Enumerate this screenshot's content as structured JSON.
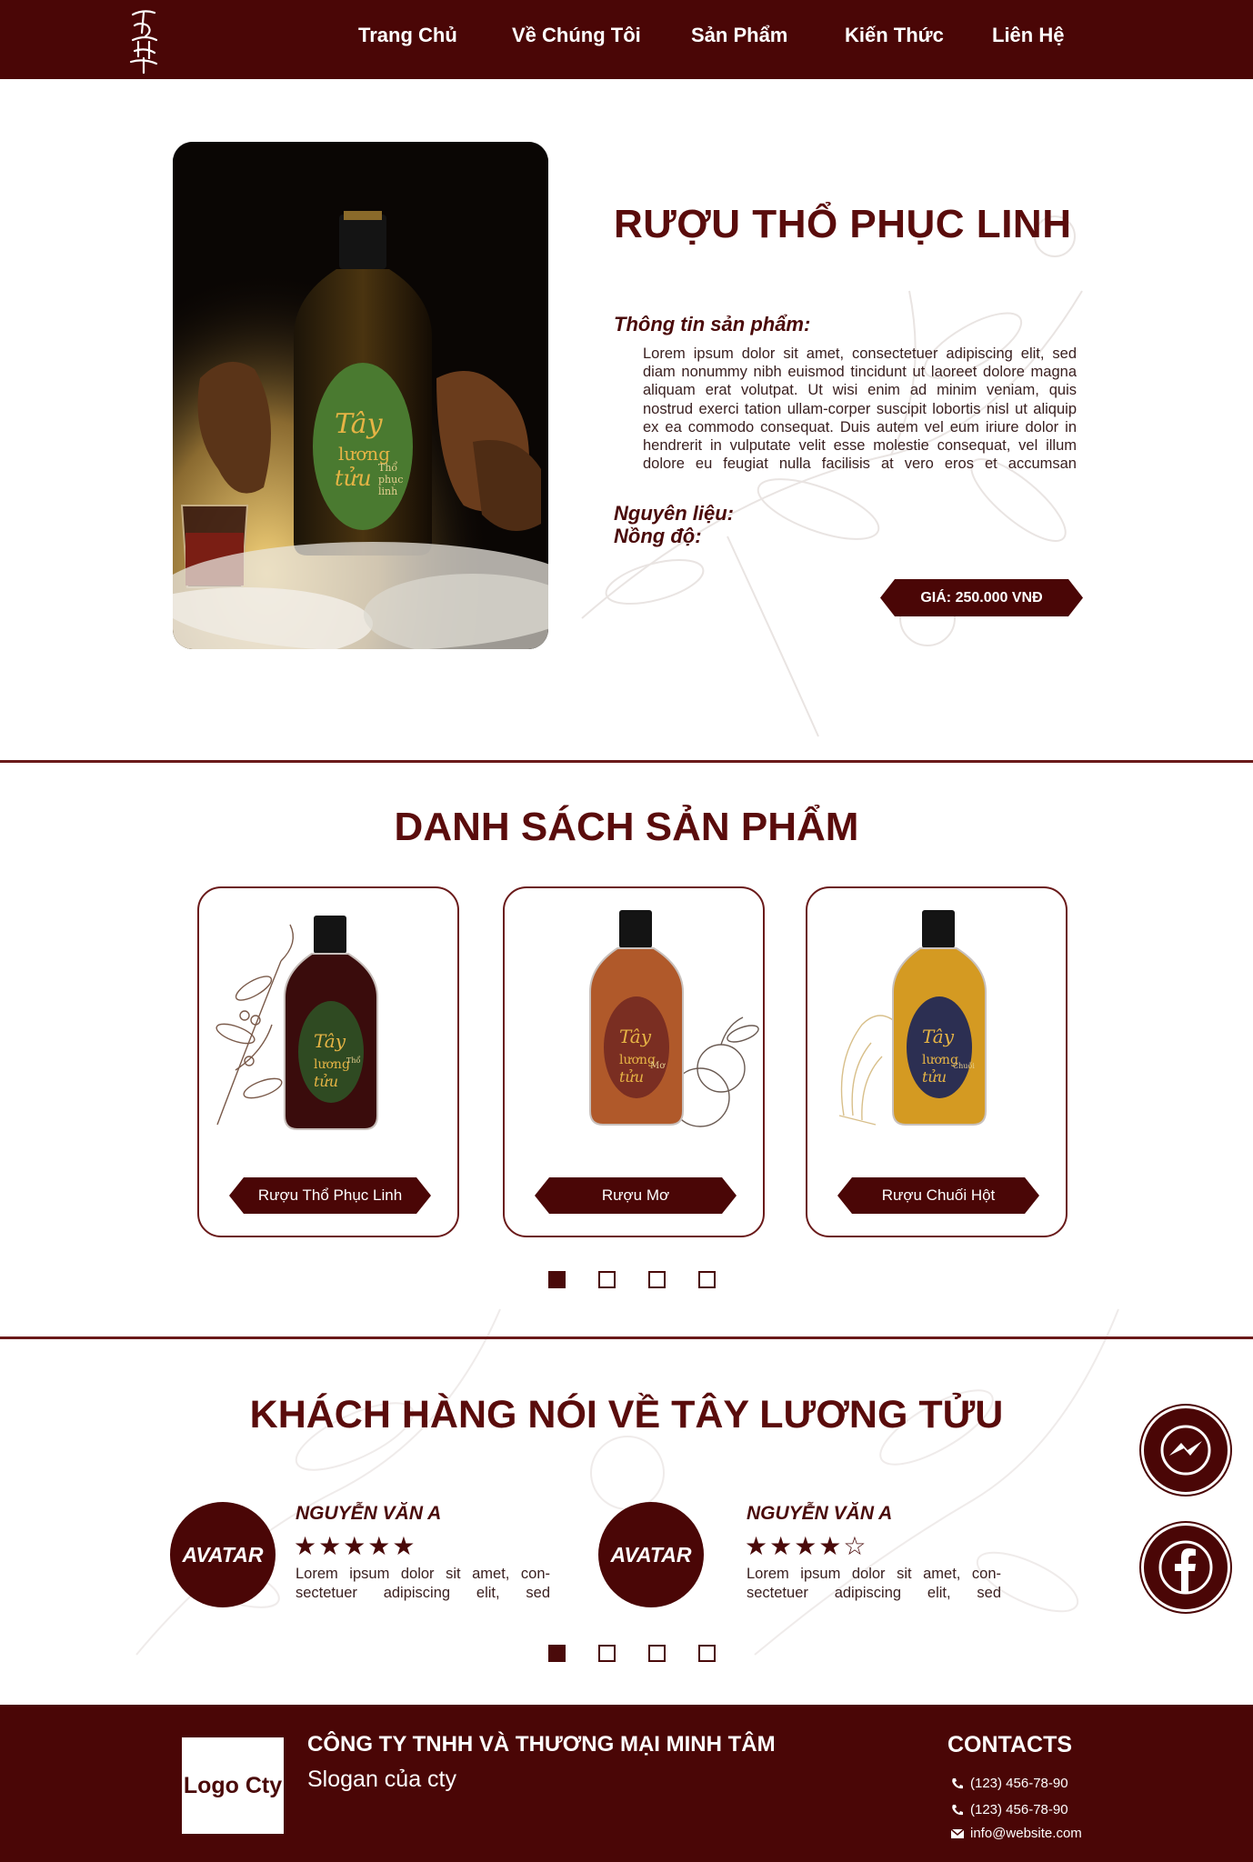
{
  "nav": {
    "logo_text": "Tây Lương Tửu",
    "items": [
      "Trang Chủ",
      "Về Chúng Tôi",
      "Sản Phẩm",
      "Kiến Thức",
      "Liên Hệ"
    ]
  },
  "hero": {
    "title": "RƯỢU THỔ PHỤC LINH",
    "info_label": "Thông tin sản phẩm:",
    "info_text": "Lorem ipsum dolor sit amet, consectetuer adipiscing elit, sed diam nonummy nibh euismod tincidunt ut laoreet dolore magna aliquam erat volutpat. Ut wisi enim ad minim veniam, quis nostrud exerci tation ullam-corper suscipit lobortis nisl ut aliquip ex ea commodo consequat. Duis autem vel eum iriure dolor in hendrerit in vulputate velit esse molestie consequat, vel illum dolore eu feugiat nulla facilisis at vero eros et accumsan",
    "ingredients_label": "Nguyên liệu:",
    "strength_label": "Nồng độ:",
    "price": "GIÁ: 250.000 VNĐ",
    "label_line1": "Thổ",
    "label_line2": "phục",
    "label_line3": "linh"
  },
  "products": {
    "title": "DANH SÁCH SẢN PHẨM",
    "items": [
      {
        "name": "Rượu Thổ Phục Linh",
        "label_text": "Thổ phục linh",
        "liquid": "#3a0c0c",
        "label_color": "#2f4a22"
      },
      {
        "name": "Rượu Mơ",
        "label_text": "Mơ",
        "liquid": "#b0592a",
        "label_color": "#7a2e22"
      },
      {
        "name": "Rượu Chuối Hột",
        "label_text": "Chuối hột",
        "liquid": "#d49a22",
        "label_color": "#2c2f52"
      }
    ],
    "pager": {
      "count": 4,
      "active": 0
    }
  },
  "testimonials": {
    "title": "KHÁCH HÀNG NÓI VỀ TÂY LƯƠNG TỬU",
    "items": [
      {
        "avatar": "AVATAR",
        "name": "NGUYỄN VĂN A",
        "stars": "★★★★★",
        "rating": 5,
        "text": "Lorem ipsum dolor sit amet, con-sectetuer adipiscing elit, sed"
      },
      {
        "avatar": "AVATAR",
        "name": "NGUYỄN VĂN A",
        "stars": "★★★★☆",
        "rating": 4,
        "text": "Lorem ipsum dolor sit amet, con-sectetuer adipiscing elit, sed"
      }
    ],
    "pager": {
      "count": 4,
      "active": 0
    }
  },
  "floating": {
    "messenger_icon": "messenger-icon",
    "facebook_icon": "facebook-icon"
  },
  "footer": {
    "logo": "Logo Cty",
    "company": "CÔNG TY TNHH VÀ THƯƠNG MẠI MINH TÂM",
    "slogan": "Slogan của cty",
    "contacts_title": "CONTACTS",
    "phone1": "(123) 456-78-90",
    "phone2": "(123) 456-78-90",
    "email": "info@website.com"
  },
  "colors": {
    "brand": "#4a0606",
    "accent": "#5a0c0c",
    "background": "#ffffff"
  }
}
